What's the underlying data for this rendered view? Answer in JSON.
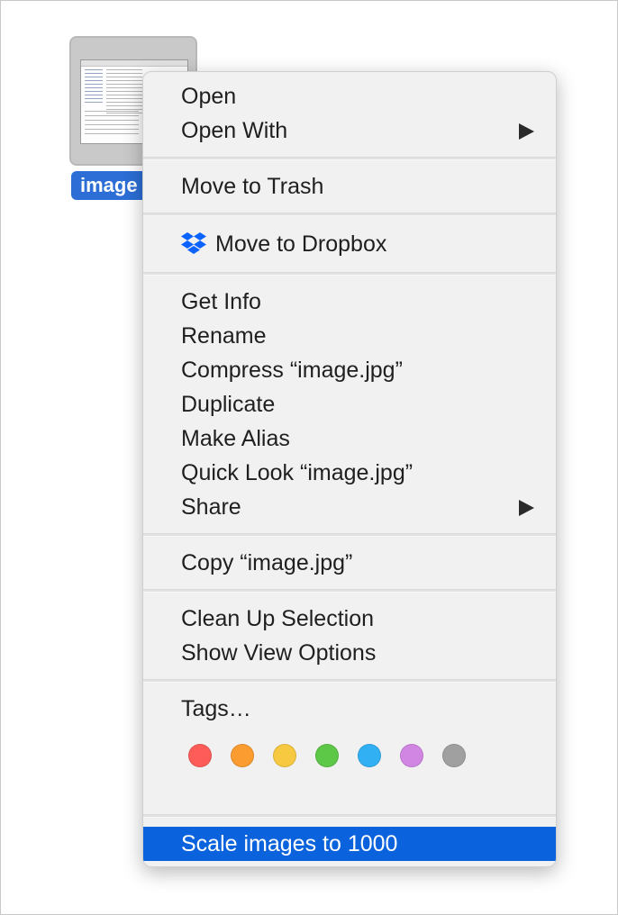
{
  "file": {
    "label": "image",
    "icon": "image-thumbnail-icon"
  },
  "menu": {
    "open": "Open",
    "open_with": "Open With",
    "move_to_trash": "Move to Trash",
    "move_to_dropbox": "Move to Dropbox",
    "get_info": "Get Info",
    "rename": "Rename",
    "compress": "Compress “image.jpg”",
    "duplicate": "Duplicate",
    "make_alias": "Make Alias",
    "quick_look": "Quick Look “image.jpg”",
    "share": "Share",
    "copy": "Copy “image.jpg”",
    "clean_up": "Clean Up Selection",
    "show_view_options": "Show View Options",
    "tags": "Tags…",
    "scale_images": "Scale images to 1000"
  },
  "tag_colors": [
    "#fd5c58",
    "#fa9c30",
    "#f6c941",
    "#5dc747",
    "#31b1f4",
    "#d186e4",
    "#a0a0a0"
  ],
  "colors": {
    "selection": "#0a63dc",
    "file_label_bg": "#2c6ed6",
    "dropbox": "#0a62ff"
  }
}
